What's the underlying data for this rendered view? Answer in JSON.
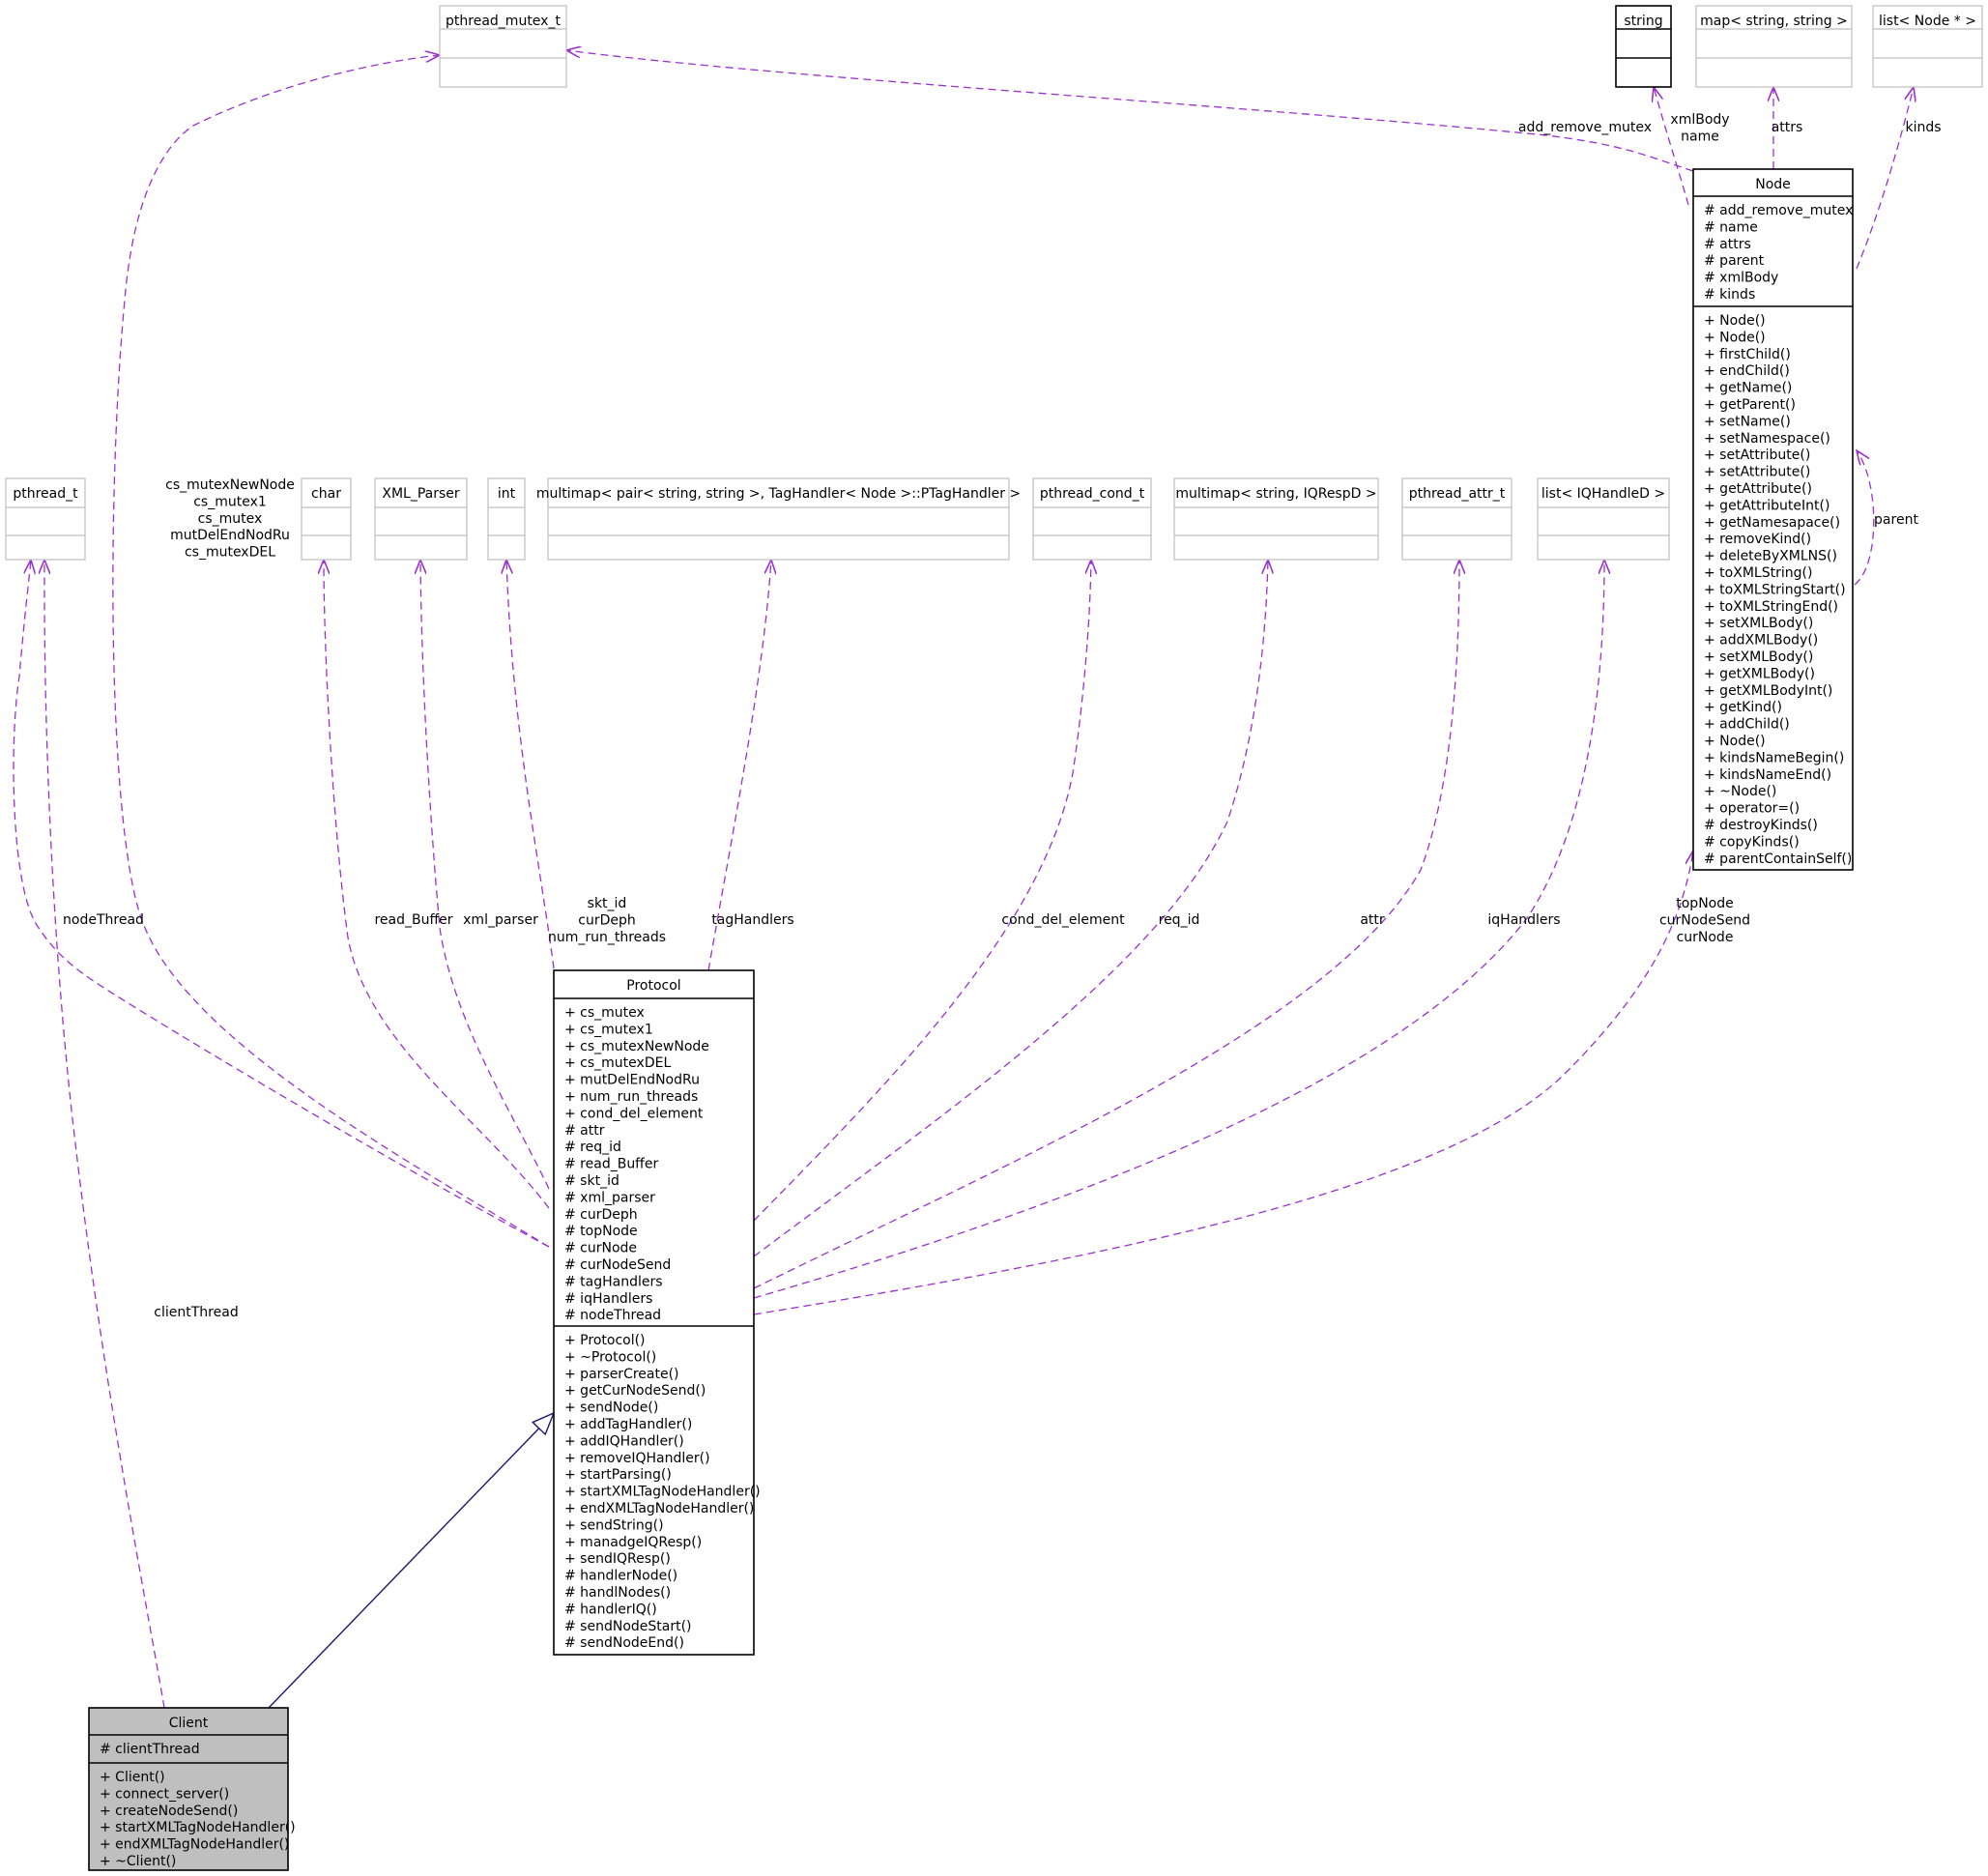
{
  "colors": {
    "dependency": "#9a32cd",
    "inheritance": "#191970",
    "box_border_dark": "#000000",
    "box_border_light": "#bfbfbf",
    "highlight_fill": "#bfbfbf"
  },
  "classes": {
    "pthread_mutex_t": {
      "name": "pthread_mutex_t",
      "attributes": [],
      "methods": []
    },
    "string": {
      "name": "string",
      "attributes": [],
      "methods": []
    },
    "map_string": {
      "name": "map< string, string >",
      "attributes": [],
      "methods": []
    },
    "list_node": {
      "name": "list< Node * >",
      "attributes": [],
      "methods": []
    },
    "node": {
      "name": "Node",
      "attributes": [
        "# add_remove_mutex",
        "# name",
        "# attrs",
        "# parent",
        "# xmlBody",
        "# kinds"
      ],
      "methods": [
        "+ Node()",
        "+ Node()",
        "+ firstChild()",
        "+ endChild()",
        "+ getName()",
        "+ getParent()",
        "+ setName()",
        "+ setNamespace()",
        "+ setAttribute()",
        "+ setAttribute()",
        "+ getAttribute()",
        "+ getAttributeInt()",
        "+ getNamesapace()",
        "+ removeKind()",
        "+ deleteByXMLNS()",
        "+ toXMLString()",
        "+ toXMLStringStart()",
        "+ toXMLStringEnd()",
        "+ setXMLBody()",
        "+ addXMLBody()",
        "+ setXMLBody()",
        "+ getXMLBody()",
        "+ getXMLBodyInt()",
        "+ getKind()",
        "+ addChild()",
        "+ Node()",
        "+ kindsNameBegin()",
        "+ kindsNameEnd()",
        "+ ~Node()",
        "+ operator=()",
        "# destroyKinds()",
        "# copyKinds()",
        "# parentContainSelf()"
      ]
    },
    "pthread_t": {
      "name": "pthread_t",
      "attributes": [],
      "methods": []
    },
    "char": {
      "name": "char",
      "attributes": [],
      "methods": []
    },
    "xml_parser": {
      "name": "XML_Parser",
      "attributes": [],
      "methods": []
    },
    "int": {
      "name": "int",
      "attributes": [],
      "methods": []
    },
    "multimap_pair": {
      "name": "multimap< pair< string, string >, TagHandler< Node >::PTagHandler >",
      "attributes": [],
      "methods": []
    },
    "pthread_cond_t": {
      "name": "pthread_cond_t",
      "attributes": [],
      "methods": []
    },
    "multimap_iq": {
      "name": "multimap< string, IQRespD >",
      "attributes": [],
      "methods": []
    },
    "pthread_attr_t": {
      "name": "pthread_attr_t",
      "attributes": [],
      "methods": []
    },
    "list_iq": {
      "name": "list< IQHandleD >",
      "attributes": [],
      "methods": []
    },
    "protocol": {
      "name": "Protocol",
      "attributes": [
        "+ cs_mutex",
        "+ cs_mutex1",
        "+ cs_mutexNewNode",
        "+ cs_mutexDEL",
        "+ mutDelEndNodRu",
        "+ num_run_threads",
        "+ cond_del_element",
        "# attr",
        "# req_id",
        "# read_Buffer",
        "# skt_id",
        "# xml_parser",
        "# curDeph",
        "# topNode",
        "# curNode",
        "# curNodeSend",
        "# tagHandlers",
        "# iqHandlers",
        "# nodeThread"
      ],
      "methods": [
        "+ Protocol()",
        "+ ~Protocol()",
        "+ parserCreate()",
        "+ getCurNodeSend()",
        "+ sendNode()",
        "+ addTagHandler()",
        "+ addIQHandler()",
        "+ removeIQHandler()",
        "+ startParsing()",
        "+ startXMLTagNodeHandler()",
        "+ endXMLTagNodeHandler()",
        "+ sendString()",
        "+ manadgeIQResp()",
        "+ sendIQResp()",
        "# handlerNode()",
        "# handlNodes()",
        "# handlerIQ()",
        "# sendNodeStart()",
        "# sendNodeEnd()"
      ]
    },
    "client": {
      "name": "Client",
      "attributes": [
        "# clientThread"
      ],
      "methods": [
        "+ Client()",
        "+ connect_server()",
        "+ createNodeSend()",
        "+ startXMLTagNodeHandler()",
        "+ endXMLTagNodeHandler()",
        "+ ~Client()"
      ]
    }
  },
  "edge_labels": {
    "add_remove_mutex": [
      "add_remove_mutex"
    ],
    "xmlbody_name": [
      "xmlBody",
      "name"
    ],
    "attrs": [
      "attrs"
    ],
    "kinds": [
      "kinds"
    ],
    "parent": [
      "parent"
    ],
    "cs_mutex_group": [
      "cs_mutexNewNode",
      "cs_mutex1",
      "cs_mutex",
      "mutDelEndNodRu",
      "cs_mutexDEL"
    ],
    "node_thread": [
      "nodeThread"
    ],
    "read_buffer": [
      "read_Buffer"
    ],
    "xml_parser": [
      "xml_parser"
    ],
    "skt_group": [
      "skt_id",
      "curDeph",
      "num_run_threads"
    ],
    "tag_handlers": [
      "tagHandlers"
    ],
    "cond_del_element": [
      "cond_del_element"
    ],
    "req_id": [
      "req_id"
    ],
    "attr": [
      "attr"
    ],
    "iq_handlers": [
      "iqHandlers"
    ],
    "top_node_group": [
      "topNode",
      "curNodeSend",
      "curNode"
    ],
    "client_thread": [
      "clientThread"
    ]
  }
}
